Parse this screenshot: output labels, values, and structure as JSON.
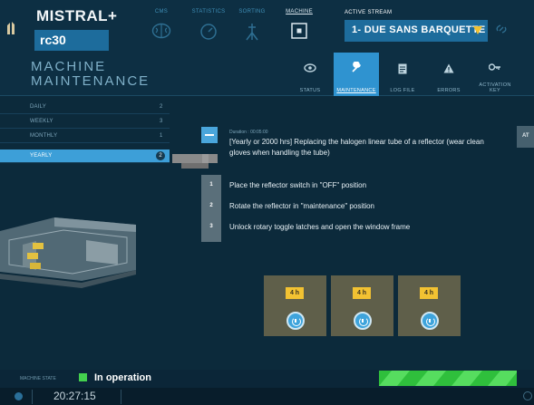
{
  "colors": {
    "accent": "#2f93d0",
    "active_row": "#3d9fd8",
    "status_ok": "#43d04e",
    "timer_badge": "#f2c232"
  },
  "header": {
    "brand": "MISTRAL+",
    "machine_id": "rc30",
    "nav": [
      {
        "label": "CMS",
        "icon": "brain-icon"
      },
      {
        "label": "STATISTICS",
        "icon": "gauge-icon"
      },
      {
        "label": "SORTING",
        "icon": "sorting-icon"
      },
      {
        "label": "MACHINE",
        "icon": "machine-icon",
        "active": true
      }
    ],
    "active_stream_label": "ACTIVE STREAM",
    "active_stream_value": "1- DUE SANS BARQUETTE"
  },
  "page": {
    "title_line1": "MACHINE",
    "title_line2": "MAINTENANCE"
  },
  "tabs": [
    {
      "label": "STATUS",
      "icon": "eye-icon"
    },
    {
      "label": "MAINTENANCE",
      "icon": "wrench-icon",
      "active": true
    },
    {
      "label": "LOG FILE",
      "icon": "log-file-icon"
    },
    {
      "label": "ERRORS",
      "icon": "warning-icon"
    },
    {
      "label": "ACTIVATION",
      "label2": "KEY",
      "icon": "key-icon"
    }
  ],
  "sidebar": {
    "items": [
      {
        "label": "DAILY",
        "count": "2"
      },
      {
        "label": "WEEKLY",
        "count": "3"
      },
      {
        "label": "MONTHLY",
        "count": "1"
      },
      {
        "label": "YEARLY",
        "count": "2",
        "active": true
      }
    ]
  },
  "task": {
    "duration": "Duration : 00:05:00",
    "title": "[Yearly or 2000 hrs] Replacing the halogen linear tube of a reflector (wear clean gloves when handling the tube)",
    "edge_button": "AT",
    "steps": [
      {
        "num": "1",
        "text": "Place the reflector switch in \"OFF\" position"
      },
      {
        "num": "2",
        "text": "Rotate the reflector in \"maintenance\" position"
      },
      {
        "num": "3",
        "text": "Unlock rotary toggle latches and open the window frame"
      }
    ]
  },
  "timers": [
    {
      "badge": "4 h"
    },
    {
      "badge": "4 h"
    },
    {
      "badge": "4 h"
    }
  ],
  "footer": {
    "machine_state_label": "MACHINE STATE",
    "machine_state": "In operation",
    "clock": "20:27:15"
  }
}
